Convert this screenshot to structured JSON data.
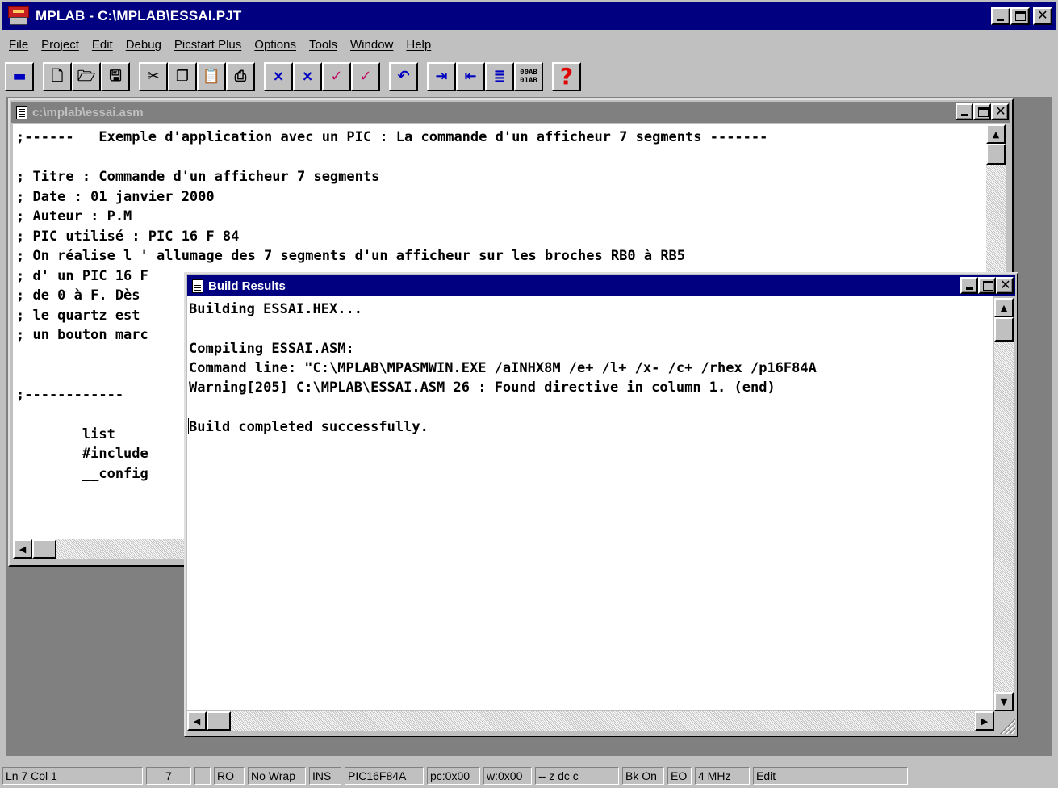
{
  "window": {
    "title": "MPLAB - C:\\MPLAB\\ESSAI.PJT"
  },
  "menu": [
    "File",
    "Project",
    "Edit",
    "Debug",
    "Picstart Plus",
    "Options",
    "Tools",
    "Window",
    "Help"
  ],
  "toolbar": {
    "icons": [
      "project-icon",
      "new-file-icon",
      "open-file-icon",
      "save-icon",
      "cut-icon",
      "copy-icon",
      "paste-icon",
      "print-icon",
      "clear-breakpoints-icon",
      "breakpoint-settings-icon",
      "trace-icon",
      "trace-settings-icon",
      "undo-icon",
      "indent-icon",
      "outdent-icon",
      "match-brace-icon",
      "hex-view-icon",
      "help-icon"
    ],
    "hex_label": "00AB\n01AB",
    "help_glyph": "?"
  },
  "editor": {
    "title": "c:\\mplab\\essai.asm",
    "lines": [
      ";------   Exemple d'application avec un PIC : La commande d'un afficheur 7 segments -------",
      "",
      "; Titre : Commande d'un afficheur 7 segments",
      "; Date : 01 janvier 2000",
      "; Auteur : P.M",
      "; PIC utilisé : PIC 16 F 84",
      "; On réalise l ' allumage des 7 segments d'un afficheur sur les broches RB0 à RB5",
      "; d' un PIC 16 F",
      "; de 0 à F. Dès",
      "; le quartz est",
      "; un bouton marc",
      "",
      "",
      ";------------",
      "",
      "        list",
      "        #include",
      "        __config"
    ]
  },
  "build": {
    "title": "Build Results",
    "lines": [
      "Building ESSAI.HEX...",
      "",
      "Compiling ESSAI.ASM:",
      "Command line: \"C:\\MPLAB\\MPASMWIN.EXE /aINHX8M /e+ /l+ /x- /c+ /rhex /p16F84A",
      "Warning[205] C:\\MPLAB\\ESSAI.ASM 26 : Found directive in column 1. (end)",
      "",
      "Build completed successfully."
    ]
  },
  "status": [
    "Ln 7 Col 1",
    "7",
    "",
    "RO",
    "No Wrap",
    "INS",
    "PIC16F84A",
    "pc:0x00",
    "w:0x00",
    "-- z dc c",
    "Bk On",
    "EO",
    "4 MHz",
    "Edit"
  ]
}
